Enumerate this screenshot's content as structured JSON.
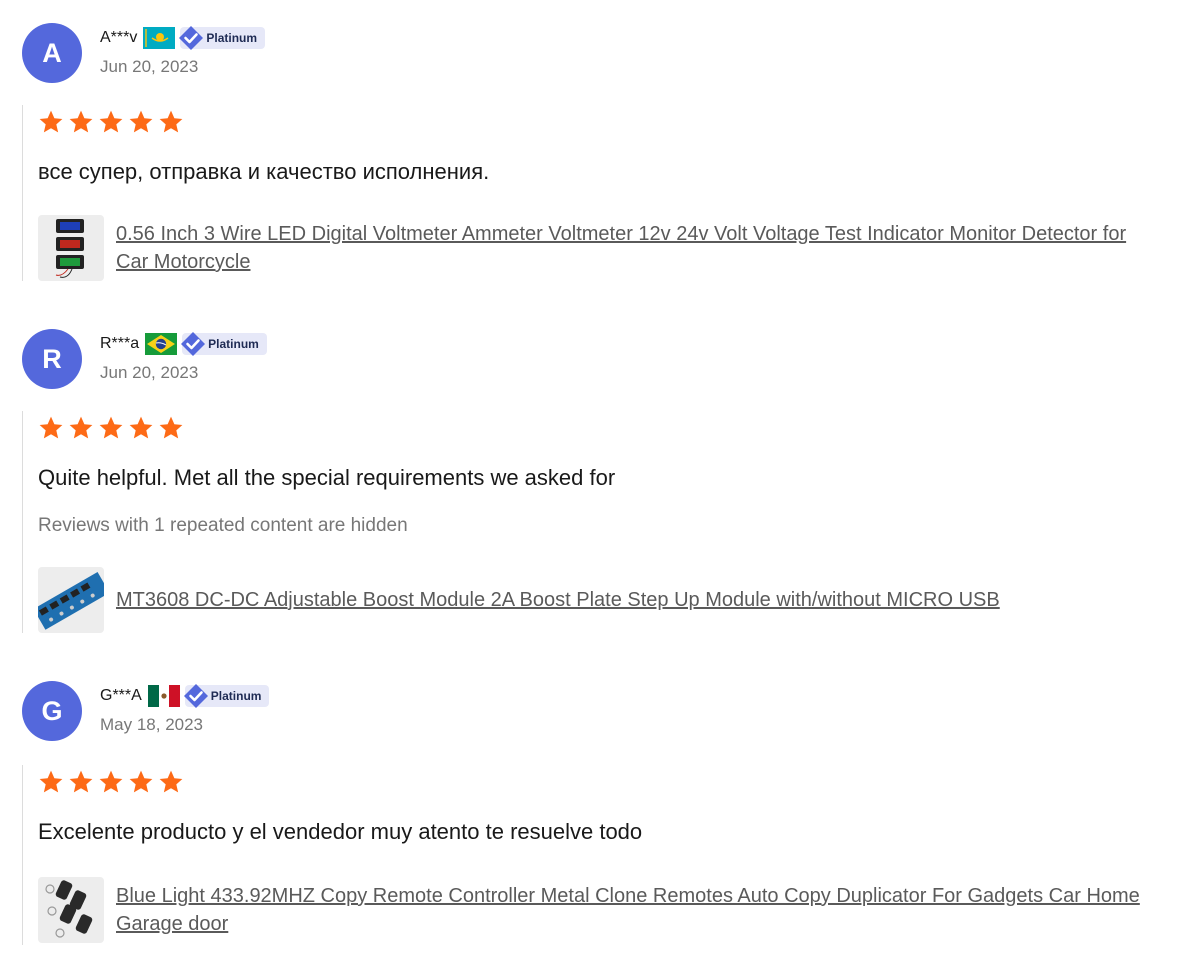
{
  "reviews": [
    {
      "avatar_letter": "A",
      "username": "A***v",
      "country_flag": "kazakhstan-flag",
      "badge": "Platinum",
      "date": "Jun 20, 2023",
      "rating": 5,
      "comment": "все супер, отправка и качество исполнения.",
      "product_title": "0.56 Inch 3 Wire LED Digital Voltmeter Ammeter Voltmeter 12v 24v Volt Voltage Test Indicator Monitor Detector for Car Motorcycle"
    },
    {
      "avatar_letter": "R",
      "username": "R***a",
      "country_flag": "brazil-flag",
      "badge": "Platinum",
      "date": "Jun 20, 2023",
      "rating": 5,
      "comment": "Quite helpful. Met all the special requirements we asked for",
      "hidden_note": "Reviews with 1 repeated content are hidden",
      "product_title": "MT3608 DC-DC Adjustable Boost Module 2A Boost Plate Step Up Module with/without MICRO USB"
    },
    {
      "avatar_letter": "G",
      "username": "G***A",
      "country_flag": "mexico-flag",
      "badge": "Platinum",
      "date": "May 18, 2023",
      "rating": 5,
      "comment": "Excelente producto y el vendedor muy atento te resuelve todo",
      "product_title": "Blue Light 433.92MHZ Copy Remote Controller Metal Clone Remotes Auto Copy Duplicator For Gadgets Car Home Garage door"
    }
  ],
  "colors": {
    "avatar": "#5468dc",
    "star": "#fd6a16",
    "badge_bg": "#e6e8f8",
    "badge_icon": "#5468dc",
    "muted_text": "#777777",
    "link_text": "#5a5a5a"
  }
}
